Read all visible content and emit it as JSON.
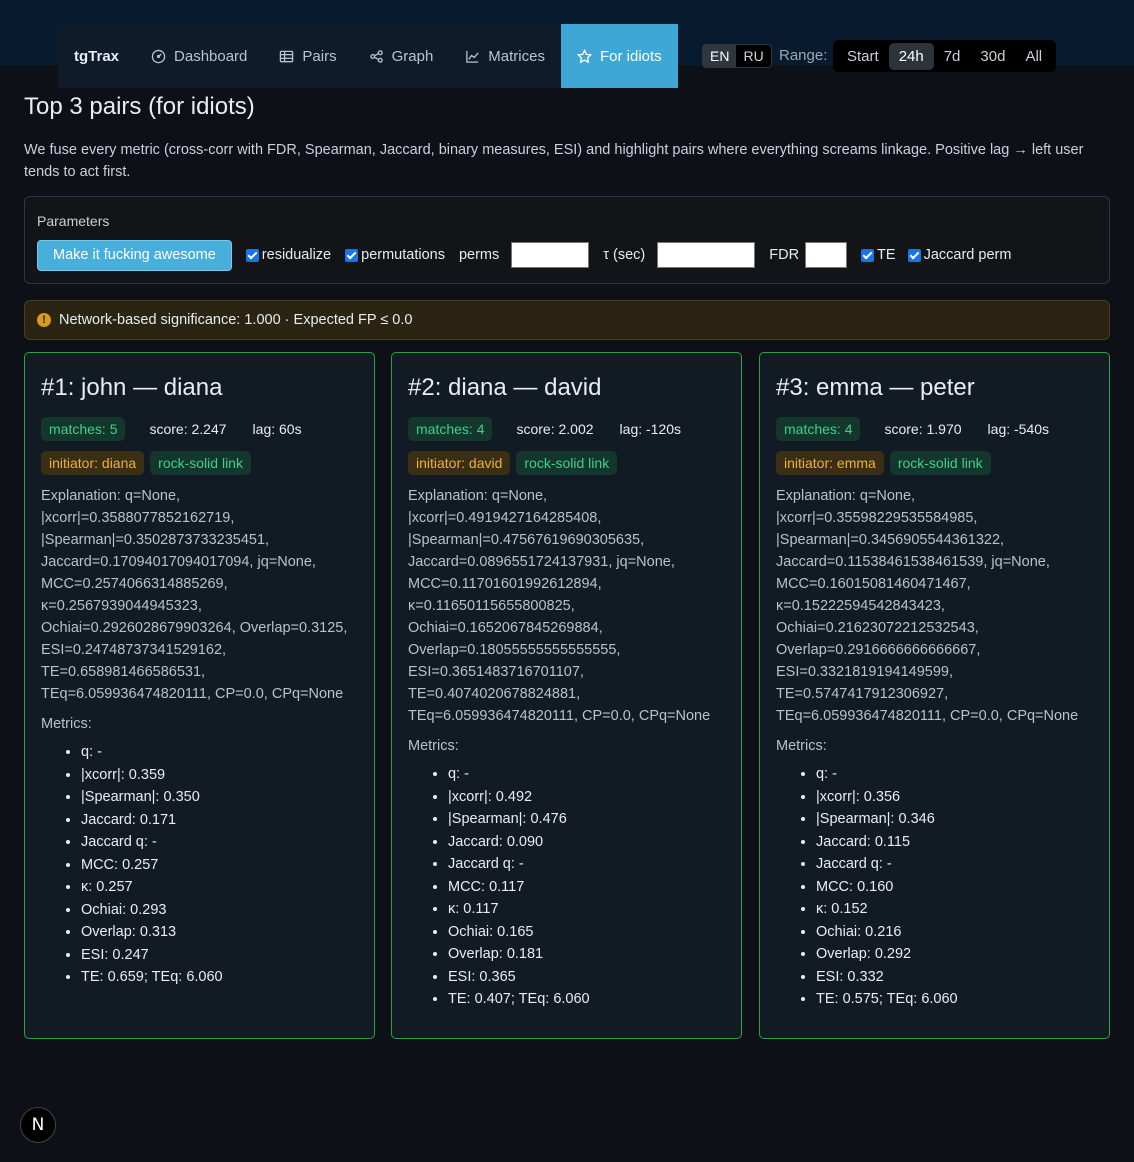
{
  "nav": {
    "brand": "tgTrax",
    "items": [
      {
        "label": "Dashboard"
      },
      {
        "label": "Pairs"
      },
      {
        "label": "Graph"
      },
      {
        "label": "Matrices"
      },
      {
        "label": "For idiots"
      }
    ],
    "active_item": "For idiots",
    "languages": [
      "EN",
      "RU"
    ],
    "active_language": "EN",
    "range_label": "Range:",
    "ranges": [
      "Start",
      "24h",
      "7d",
      "30d",
      "All"
    ],
    "active_range": "24h"
  },
  "page": {
    "title": "Top 3 pairs (for idiots)",
    "description": "We fuse every metric (cross-corr with FDR, Spearman, Jaccard, binary measures, ESI) and highlight pairs where everything screams linkage. Positive lag → left user tends to act first."
  },
  "params": {
    "title": "Parameters",
    "run_button": "Make it fucking awesome",
    "residualize": {
      "label": "residualize",
      "checked": true
    },
    "permutations": {
      "label": "permutations",
      "checked": true
    },
    "perms_label": "perms",
    "perms_value": "",
    "tau_label": "τ (sec)",
    "tau_value": "",
    "fdr_label": "FDR",
    "fdr_value": "",
    "te": {
      "label": "TE",
      "checked": true
    },
    "jaccard_perm": {
      "label": "Jaccard perm",
      "checked": true
    }
  },
  "alert": {
    "text": "Network-based significance: 1.000 · Expected FP ≤ 0.0"
  },
  "cards": [
    {
      "title": "#1: john — diana",
      "matches": "matches: 5",
      "score": "score: 2.247",
      "lag": "lag: 60s",
      "initiator": "initiator: diana",
      "link": "rock-solid link",
      "explanation": "Explanation: q=None, |xcorr|=0.3588077852162719, |Spearman|=0.3502873733235451, Jaccard=0.17094017094017094, jq=None, MCC=0.2574066314885269, κ=0.2567939044945323, Ochiai=0.2926028679903264, Overlap=0.3125, ESI=0.24748737341529162, TE=0.658981466586531, TEq=6.059936474820111, CP=0.0, CPq=None",
      "metrics_title": "Metrics:",
      "metrics": [
        "q: -",
        "|xcorr|: 0.359",
        "|Spearman|: 0.350",
        "Jaccard: 0.171",
        "Jaccard q: -",
        "MCC: 0.257",
        "κ: 0.257",
        "Ochiai: 0.293",
        "Overlap: 0.313",
        "ESI: 0.247",
        "TE: 0.659; TEq: 6.060"
      ]
    },
    {
      "title": "#2: diana — david",
      "matches": "matches: 4",
      "score": "score: 2.002",
      "lag": "lag: -120s",
      "initiator": "initiator: david",
      "link": "rock-solid link",
      "explanation": "Explanation: q=None, |xcorr|=0.4919427164285408, |Spearman|=0.47567619690305635, Jaccard=0.0896551724137931, jq=None, MCC=0.11701601992612894, κ=0.11650115655800825, Ochiai=0.1652067845269884, Overlap=0.18055555555555555, ESI=0.3651483716701107, TE=0.4074020678824881, TEq=6.059936474820111, CP=0.0, CPq=None",
      "metrics_title": "Metrics:",
      "metrics": [
        "q: -",
        "|xcorr|: 0.492",
        "|Spearman|: 0.476",
        "Jaccard: 0.090",
        "Jaccard q: -",
        "MCC: 0.117",
        "κ: 0.117",
        "Ochiai: 0.165",
        "Overlap: 0.181",
        "ESI: 0.365",
        "TE: 0.407; TEq: 6.060"
      ]
    },
    {
      "title": "#3: emma — peter",
      "matches": "matches: 4",
      "score": "score: 1.970",
      "lag": "lag: -540s",
      "initiator": "initiator: emma",
      "link": "rock-solid link",
      "explanation": "Explanation: q=None, |xcorr|=0.35598229535584985, |Spearman|=0.3456905544361322, Jaccard=0.11538461538461539, jq=None, MCC=0.16015081460471467, κ=0.15222594542843423, Ochiai=0.21623072212532543, Overlap=0.2916666666666667, ESI=0.3321819194149599, TE=0.5747417912306927, TEq=6.059936474820111, CP=0.0, CPq=None",
      "metrics_title": "Metrics:",
      "metrics": [
        "q: -",
        "|xcorr|: 0.356",
        "|Spearman|: 0.346",
        "Jaccard: 0.115",
        "Jaccard q: -",
        "MCC: 0.160",
        "κ: 0.152",
        "Ochiai: 0.216",
        "Overlap: 0.292",
        "ESI: 0.332",
        "TE: 0.575; TEq: 6.060"
      ]
    }
  ],
  "footer": {
    "logo_letter": "N"
  },
  "colors": {
    "accent": "#3fa7d6",
    "card_border": "#2ea043",
    "badge_green": "#3fcf8e",
    "badge_amber": "#e8b339"
  }
}
